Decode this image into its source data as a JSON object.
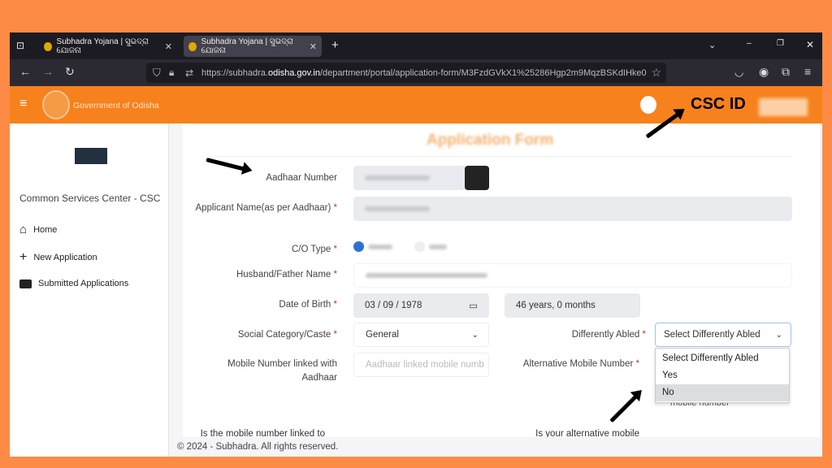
{
  "browser": {
    "tabs": [
      {
        "title": "Subhadra Yojana | ସୁଭଦ୍ରା ଯୋଜନା"
      },
      {
        "title": "Subhadra Yojana | ସୁଭଦ୍ରା ଯୋଜନା"
      }
    ],
    "url_prefix": "https://subhadra.",
    "url_domain": "odisha.gov.in",
    "url_path": "/department/portal/application-form/M3FzdGVkX1%25286Hgp2m9MqzBSKdIHke0",
    "window_controls": {
      "minimize": "–",
      "restore": "❐",
      "close": "✕"
    }
  },
  "header": {
    "menu_icon": "≡",
    "brand": "Government of Odisha",
    "csc_id_label": "CSC ID"
  },
  "sidebar": {
    "org": "Common Services Center - CSC",
    "items": [
      {
        "label": "Home",
        "icon": "home-icon"
      },
      {
        "label": "New Application",
        "icon": "plus-icon"
      },
      {
        "label": "Submitted Applications",
        "icon": "inbox-icon"
      }
    ]
  },
  "form": {
    "title": "Application Form",
    "aadhaar_label": "Aadhaar Number",
    "applicant_label": "Applicant Name(as per Aadhaar)",
    "co_type_label": "C/O Type",
    "husband_label": "Husband/Father Name",
    "dob_label": "Date of Birth",
    "dob_value": "03 / 09 / 1978",
    "age_value": "46 years, 0 months",
    "caste_label": "Social Category/Caste",
    "caste_value": "General",
    "diff_label": "Differently Abled",
    "diff_value": "Select Differently Abled",
    "diff_options": [
      "Select Differently Abled",
      "Yes",
      "No"
    ],
    "diff_highlighted": "No",
    "mobile_label": "Mobile Number linked with Aadhaar",
    "mobile_placeholder": "Aadhaar linked mobile numb",
    "alt_mobile_label": "Alternative Mobile Number",
    "alt_mobile_hint": "mobile number",
    "linked_q": "Is the mobile number linked to",
    "alt_q": "Is your alternative mobile",
    "required_mark": "*"
  },
  "footer": {
    "text": "© 2024 - Subhadra. All rights reserved."
  },
  "colors": {
    "brand_orange": "#f7811c",
    "frame": "#fd8b45"
  }
}
